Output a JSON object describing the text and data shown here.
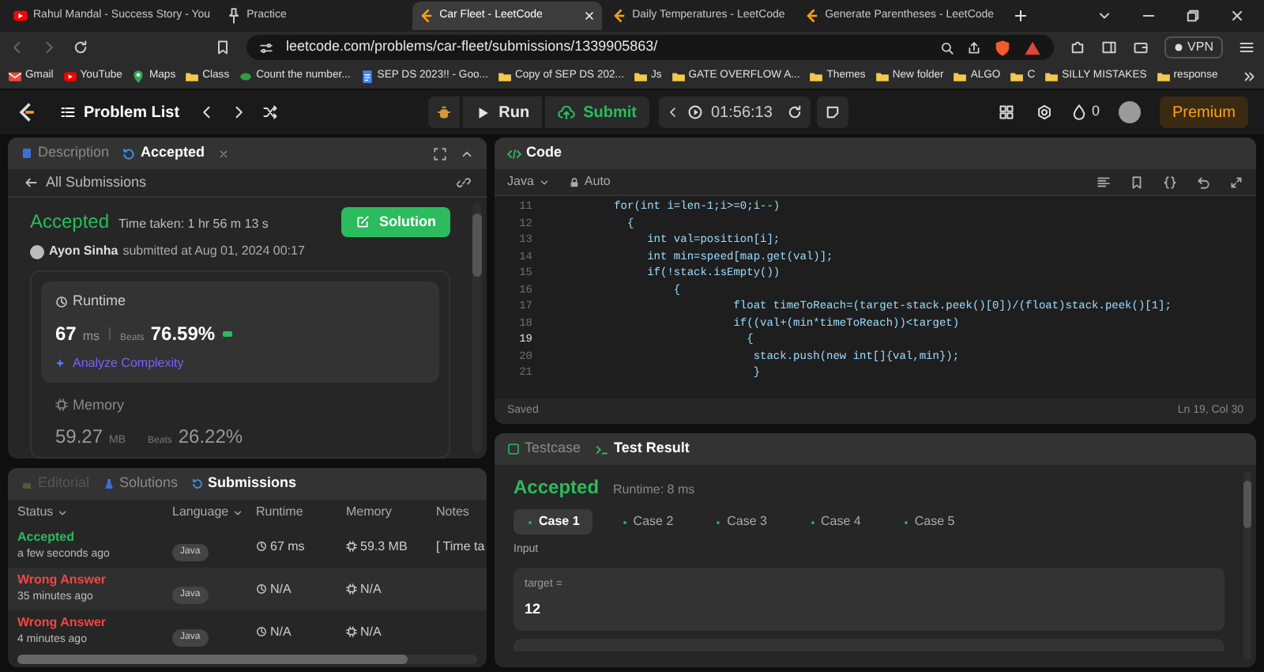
{
  "browser": {
    "tabs": [
      {
        "title": "Rahul Mandal - Success Story - You",
        "selected": false,
        "kind": "video"
      },
      {
        "title": "Practice",
        "selected": false,
        "kind": "pin"
      },
      {
        "title": "Car Fleet - LeetCode",
        "selected": true,
        "kind": "leetcode"
      },
      {
        "title": "Daily Temperatures - LeetCode",
        "selected": false,
        "kind": "leetcode"
      },
      {
        "title": "Generate Parentheses - LeetCode",
        "selected": false,
        "kind": "leetcode"
      }
    ],
    "url": "leetcode.com/problems/car-fleet/submissions/1339905863/",
    "vpn": "VPN",
    "bookmarks": [
      {
        "label": "Gmail",
        "kind": "mail"
      },
      {
        "label": "YouTube",
        "kind": "video"
      },
      {
        "label": "Maps",
        "kind": "map"
      },
      {
        "label": "Class",
        "kind": "folder"
      },
      {
        "label": "Count the number...",
        "kind": "site"
      },
      {
        "label": "SEP DS 2023!! - Goo...",
        "kind": "doc"
      },
      {
        "label": "Copy of SEP DS 202...",
        "kind": "folder"
      },
      {
        "label": "Js",
        "kind": "folder"
      },
      {
        "label": "GATE OVERFLOW A...",
        "kind": "folder"
      },
      {
        "label": "Themes",
        "kind": "folder"
      },
      {
        "label": "New folder",
        "kind": "folder"
      },
      {
        "label": "ALGO",
        "kind": "folder"
      },
      {
        "label": "C",
        "kind": "folder"
      },
      {
        "label": "SILLY MISTAKES",
        "kind": "folder"
      },
      {
        "label": "response",
        "kind": "folder"
      }
    ]
  },
  "nav": {
    "problem_list": "Problem List",
    "run": "Run",
    "submit": "Submit",
    "timer": "01:56:13",
    "streak": "0",
    "premium": "Premium"
  },
  "left_panel": {
    "tabs": [
      {
        "label": "Description",
        "selected": false
      },
      {
        "label": "Accepted",
        "selected": true
      }
    ],
    "back": "All Submissions",
    "status": "Accepted",
    "time_taken": "Time taken: 1 hr 56 m 13 s",
    "user": "Ayon Sinha",
    "submitted": "submitted at Aug 01, 2024 00:17",
    "solution_button": "Solution",
    "runtime": {
      "title": "Runtime",
      "value": "67",
      "unit": "ms",
      "beats_label": "Beats",
      "beats": "76.59%",
      "analyze": "Analyze Complexity"
    },
    "memory": {
      "title": "Memory",
      "value": "59.27",
      "unit": "MB",
      "beats_label": "Beats",
      "beats": "26.22%"
    }
  },
  "code_panel": {
    "title": "Code",
    "language": "Java",
    "mode": "Auto",
    "lines": [
      {
        "number": "11",
        "text": "        for(int i=len-1;i>=0;i--)",
        "current": false
      },
      {
        "number": "12",
        "text": "          {",
        "current": false
      },
      {
        "number": "13",
        "text": "             int val=position[i];",
        "current": false
      },
      {
        "number": "14",
        "text": "             int min=speed[map.get(val)];",
        "current": false
      },
      {
        "number": "15",
        "text": "             if(!stack.isEmpty())",
        "current": false
      },
      {
        "number": "16",
        "text": "                 {",
        "current": false
      },
      {
        "number": "17",
        "text": "                          float timeToReach=(target-stack.peek()[0])/(float)stack.peek()[1];",
        "current": false
      },
      {
        "number": "18",
        "text": "                          if((val+(min*timeToReach))<target)",
        "current": false
      },
      {
        "number": "19",
        "text": "                            {",
        "current": true
      },
      {
        "number": "20",
        "text": "                             stack.push(new int[]{val,min});",
        "current": false
      },
      {
        "number": "21",
        "text": "                             }",
        "current": false
      }
    ],
    "status": "Saved",
    "cursor": "Ln 19, Col 30"
  },
  "submissions_panel": {
    "tabs": [
      {
        "label": "Editorial",
        "selected": false,
        "disabled": true
      },
      {
        "label": "Solutions",
        "selected": false,
        "disabled": false
      },
      {
        "label": "Submissions",
        "selected": true,
        "disabled": false
      }
    ],
    "columns": [
      "Status",
      "Language",
      "Runtime",
      "Memory",
      "Notes"
    ],
    "rows": [
      {
        "status": "Accepted",
        "kind": "accepted",
        "time": "a few seconds ago",
        "language": "Java",
        "runtime": "67 ms",
        "memory": "59.3 MB",
        "notes": "[ Time ta"
      },
      {
        "status": "Wrong Answer",
        "kind": "wrong",
        "time": "35 minutes ago",
        "language": "Java",
        "runtime": "N/A",
        "memory": "N/A"
      },
      {
        "status": "Wrong Answer",
        "kind": "wrong",
        "time": "4 minutes ago",
        "language": "Java",
        "runtime": "N/A",
        "memory": "N/A"
      }
    ]
  },
  "result_panel": {
    "tabs": [
      {
        "label": "Testcase",
        "selected": false
      },
      {
        "label": "Test Result",
        "selected": true
      }
    ],
    "verdict": "Accepted",
    "runtime": "Runtime: 8 ms",
    "cases": [
      {
        "label": "Case 1",
        "selected": true
      },
      {
        "label": "Case 2",
        "selected": false
      },
      {
        "label": "Case 3",
        "selected": false
      },
      {
        "label": "Case 4",
        "selected": false
      },
      {
        "label": "Case 5",
        "selected": false
      }
    ],
    "input_label": "Input",
    "fields": [
      {
        "name": "target =",
        "value": "12"
      }
    ]
  }
}
